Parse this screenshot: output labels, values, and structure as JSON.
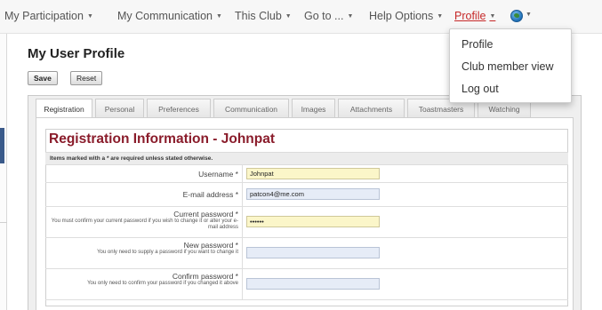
{
  "nav": {
    "items": [
      {
        "label": "My Participation"
      },
      {
        "label": "My Communication"
      },
      {
        "label": "This Club"
      },
      {
        "label": "Go to ..."
      },
      {
        "label": "Help Options"
      },
      {
        "label": "Profile"
      }
    ],
    "globe_icon": "globe-icon",
    "active_color": "#c62828"
  },
  "profile_menu": {
    "items": [
      "Profile",
      "Club member view",
      "Log out"
    ]
  },
  "page": {
    "title": "My User Profile",
    "save_label": "Save",
    "reset_label": "Reset"
  },
  "tabs": [
    "Registration",
    "Personal",
    "Preferences",
    "Communication",
    "Images",
    "Attachments",
    "Toastmasters",
    "Watching"
  ],
  "active_tab": "Registration",
  "form": {
    "title": "Registration Information - Johnpat",
    "note": "Items marked with a * are required unless stated otherwise.",
    "title_color": "#8a1c2b",
    "fields": [
      {
        "label": "Username *",
        "help": "",
        "value": "Johnpat"
      },
      {
        "label": "E-mail address *",
        "help": "",
        "value": "patcon4@me.com"
      },
      {
        "label": "Current password *",
        "help": "You must confirm your current password if you wish to change it or alter your e-mail address",
        "value": "••••••"
      },
      {
        "label": "New password *",
        "help": "You only need to supply a password if you want to change it",
        "value": ""
      },
      {
        "label": "Confirm password *",
        "help": "You only need to confirm your password if you changed it above",
        "value": ""
      }
    ]
  }
}
